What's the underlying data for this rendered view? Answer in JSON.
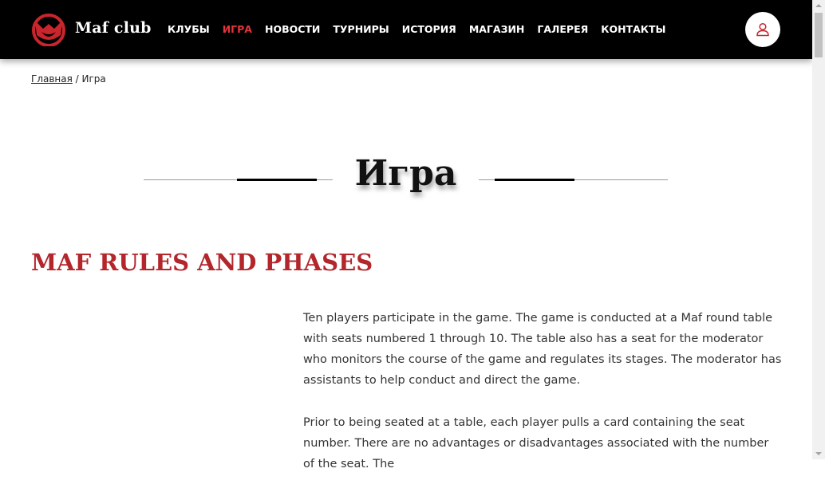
{
  "header": {
    "logo_text": "Maf club",
    "nav": [
      {
        "label": "КЛУБЫ",
        "active": false
      },
      {
        "label": "ИГРА",
        "active": true
      },
      {
        "label": "НОВОСТИ",
        "active": false
      },
      {
        "label": "ТУРНИРЫ",
        "active": false
      },
      {
        "label": "ИСТОРИЯ",
        "active": false
      },
      {
        "label": "МАГАЗИН",
        "active": false
      },
      {
        "label": "ГАЛЕРЕЯ",
        "active": false
      },
      {
        "label": "КОНТАКТЫ",
        "active": false
      }
    ],
    "user_icon": "user-icon"
  },
  "breadcrumb": {
    "home": "Главная",
    "separator": " / ",
    "current": "Игра"
  },
  "page": {
    "title": "Игра",
    "section_heading": "MAF RULES AND PHASES",
    "paragraphs": [
      "Ten players participate in the game. The game is conducted at a Maf round table with seats numbered 1 through 10. The table also has a seat for the moderator who monitors the course of the game and regulates its stages. The moderator has assistants to help conduct and direct the game.",
      "Prior to being seated at a table, each player pulls a card containing the seat number. There are no advantages or disadvantages associated with the number of the seat. The"
    ]
  },
  "colors": {
    "accent": "#e5333b",
    "heading": "#b3262b",
    "header_bg": "#000000"
  }
}
